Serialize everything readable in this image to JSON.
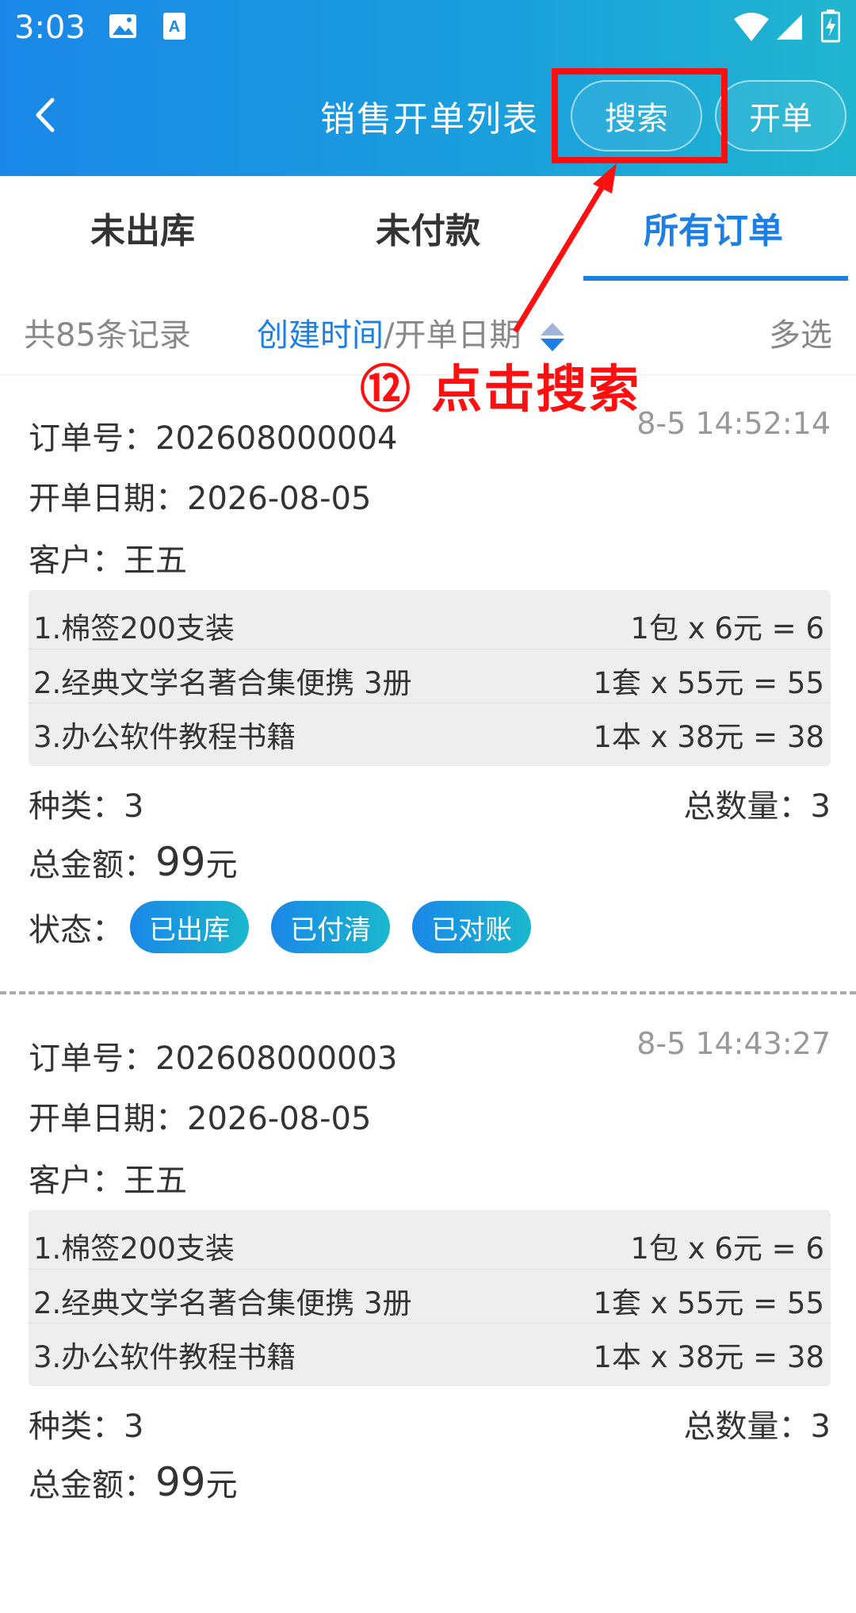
{
  "status_bar": {
    "time": "3:03"
  },
  "navbar": {
    "title": "销售开单列表",
    "search_label": "搜索",
    "open_label": "开单"
  },
  "tabs": [
    {
      "label": "未出库"
    },
    {
      "label": "未付款"
    },
    {
      "label": "所有订单"
    }
  ],
  "sortbar": {
    "count": "共85条记录",
    "sort_create": "创建时间",
    "sort_sep": "/",
    "sort_date": "开单日期",
    "multi": "多选"
  },
  "annotation": "⑫ 点击搜索",
  "orders": [
    {
      "order_no": "订单号：202608000004",
      "time": "8-5 14:52:14",
      "date": "开单日期：2026-08-05",
      "customer": "客户：王五",
      "items": [
        {
          "name": "1.棉签200支装",
          "price": "1包 x 6元 = 6"
        },
        {
          "name": "2.经典文学名著合集便携 3册",
          "price": "1套 x 55元 = 55"
        },
        {
          "name": "3.办公软件教程书籍",
          "price": "1本 x 38元 = 38"
        }
      ],
      "kinds": "种类：3",
      "qty": "总数量：3",
      "amount_label": "总金额：",
      "amount_value": "99",
      "amount_unit": "元",
      "status_label": "状态：",
      "badges": [
        "已出库",
        "已付清",
        "已对账"
      ]
    },
    {
      "order_no": "订单号：202608000003",
      "time": "8-5 14:43:27",
      "date": "开单日期：2026-08-05",
      "customer": "客户：王五",
      "items": [
        {
          "name": "1.棉签200支装",
          "price": "1包 x 6元 = 6"
        },
        {
          "name": "2.经典文学名著合集便携 3册",
          "price": "1套 x 55元 = 55"
        },
        {
          "name": "3.办公软件教程书籍",
          "price": "1本 x 38元 = 38"
        }
      ],
      "kinds": "种类：3",
      "qty": "总数量：3",
      "amount_label": "总金额：",
      "amount_value": "99",
      "amount_unit": "元"
    }
  ]
}
